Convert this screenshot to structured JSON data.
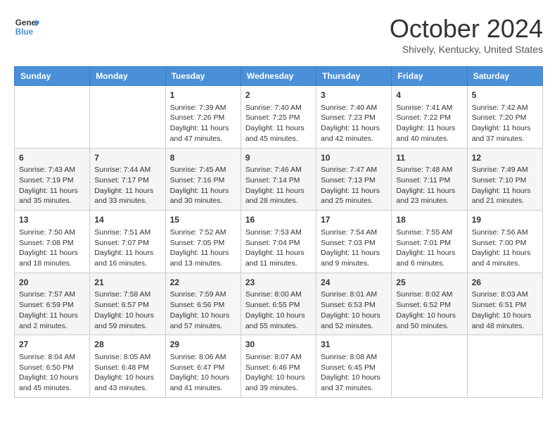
{
  "header": {
    "logo_line1": "General",
    "logo_line2": "Blue",
    "month": "October 2024",
    "location": "Shively, Kentucky, United States"
  },
  "days_of_week": [
    "Sunday",
    "Monday",
    "Tuesday",
    "Wednesday",
    "Thursday",
    "Friday",
    "Saturday"
  ],
  "weeks": [
    [
      {
        "day": "",
        "sunrise": "",
        "sunset": "",
        "daylight": ""
      },
      {
        "day": "",
        "sunrise": "",
        "sunset": "",
        "daylight": ""
      },
      {
        "day": "1",
        "sunrise": "Sunrise: 7:39 AM",
        "sunset": "Sunset: 7:26 PM",
        "daylight": "Daylight: 11 hours and 47 minutes."
      },
      {
        "day": "2",
        "sunrise": "Sunrise: 7:40 AM",
        "sunset": "Sunset: 7:25 PM",
        "daylight": "Daylight: 11 hours and 45 minutes."
      },
      {
        "day": "3",
        "sunrise": "Sunrise: 7:40 AM",
        "sunset": "Sunset: 7:23 PM",
        "daylight": "Daylight: 11 hours and 42 minutes."
      },
      {
        "day": "4",
        "sunrise": "Sunrise: 7:41 AM",
        "sunset": "Sunset: 7:22 PM",
        "daylight": "Daylight: 11 hours and 40 minutes."
      },
      {
        "day": "5",
        "sunrise": "Sunrise: 7:42 AM",
        "sunset": "Sunset: 7:20 PM",
        "daylight": "Daylight: 11 hours and 37 minutes."
      }
    ],
    [
      {
        "day": "6",
        "sunrise": "Sunrise: 7:43 AM",
        "sunset": "Sunset: 7:19 PM",
        "daylight": "Daylight: 11 hours and 35 minutes."
      },
      {
        "day": "7",
        "sunrise": "Sunrise: 7:44 AM",
        "sunset": "Sunset: 7:17 PM",
        "daylight": "Daylight: 11 hours and 33 minutes."
      },
      {
        "day": "8",
        "sunrise": "Sunrise: 7:45 AM",
        "sunset": "Sunset: 7:16 PM",
        "daylight": "Daylight: 11 hours and 30 minutes."
      },
      {
        "day": "9",
        "sunrise": "Sunrise: 7:46 AM",
        "sunset": "Sunset: 7:14 PM",
        "daylight": "Daylight: 11 hours and 28 minutes."
      },
      {
        "day": "10",
        "sunrise": "Sunrise: 7:47 AM",
        "sunset": "Sunset: 7:13 PM",
        "daylight": "Daylight: 11 hours and 25 minutes."
      },
      {
        "day": "11",
        "sunrise": "Sunrise: 7:48 AM",
        "sunset": "Sunset: 7:11 PM",
        "daylight": "Daylight: 11 hours and 23 minutes."
      },
      {
        "day": "12",
        "sunrise": "Sunrise: 7:49 AM",
        "sunset": "Sunset: 7:10 PM",
        "daylight": "Daylight: 11 hours and 21 minutes."
      }
    ],
    [
      {
        "day": "13",
        "sunrise": "Sunrise: 7:50 AM",
        "sunset": "Sunset: 7:08 PM",
        "daylight": "Daylight: 11 hours and 18 minutes."
      },
      {
        "day": "14",
        "sunrise": "Sunrise: 7:51 AM",
        "sunset": "Sunset: 7:07 PM",
        "daylight": "Daylight: 11 hours and 16 minutes."
      },
      {
        "day": "15",
        "sunrise": "Sunrise: 7:52 AM",
        "sunset": "Sunset: 7:05 PM",
        "daylight": "Daylight: 11 hours and 13 minutes."
      },
      {
        "day": "16",
        "sunrise": "Sunrise: 7:53 AM",
        "sunset": "Sunset: 7:04 PM",
        "daylight": "Daylight: 11 hours and 11 minutes."
      },
      {
        "day": "17",
        "sunrise": "Sunrise: 7:54 AM",
        "sunset": "Sunset: 7:03 PM",
        "daylight": "Daylight: 11 hours and 9 minutes."
      },
      {
        "day": "18",
        "sunrise": "Sunrise: 7:55 AM",
        "sunset": "Sunset: 7:01 PM",
        "daylight": "Daylight: 11 hours and 6 minutes."
      },
      {
        "day": "19",
        "sunrise": "Sunrise: 7:56 AM",
        "sunset": "Sunset: 7:00 PM",
        "daylight": "Daylight: 11 hours and 4 minutes."
      }
    ],
    [
      {
        "day": "20",
        "sunrise": "Sunrise: 7:57 AM",
        "sunset": "Sunset: 6:59 PM",
        "daylight": "Daylight: 11 hours and 2 minutes."
      },
      {
        "day": "21",
        "sunrise": "Sunrise: 7:58 AM",
        "sunset": "Sunset: 6:57 PM",
        "daylight": "Daylight: 10 hours and 59 minutes."
      },
      {
        "day": "22",
        "sunrise": "Sunrise: 7:59 AM",
        "sunset": "Sunset: 6:56 PM",
        "daylight": "Daylight: 10 hours and 57 minutes."
      },
      {
        "day": "23",
        "sunrise": "Sunrise: 8:00 AM",
        "sunset": "Sunset: 6:55 PM",
        "daylight": "Daylight: 10 hours and 55 minutes."
      },
      {
        "day": "24",
        "sunrise": "Sunrise: 8:01 AM",
        "sunset": "Sunset: 6:53 PM",
        "daylight": "Daylight: 10 hours and 52 minutes."
      },
      {
        "day": "25",
        "sunrise": "Sunrise: 8:02 AM",
        "sunset": "Sunset: 6:52 PM",
        "daylight": "Daylight: 10 hours and 50 minutes."
      },
      {
        "day": "26",
        "sunrise": "Sunrise: 8:03 AM",
        "sunset": "Sunset: 6:51 PM",
        "daylight": "Daylight: 10 hours and 48 minutes."
      }
    ],
    [
      {
        "day": "27",
        "sunrise": "Sunrise: 8:04 AM",
        "sunset": "Sunset: 6:50 PM",
        "daylight": "Daylight: 10 hours and 45 minutes."
      },
      {
        "day": "28",
        "sunrise": "Sunrise: 8:05 AM",
        "sunset": "Sunset: 6:48 PM",
        "daylight": "Daylight: 10 hours and 43 minutes."
      },
      {
        "day": "29",
        "sunrise": "Sunrise: 8:06 AM",
        "sunset": "Sunset: 6:47 PM",
        "daylight": "Daylight: 10 hours and 41 minutes."
      },
      {
        "day": "30",
        "sunrise": "Sunrise: 8:07 AM",
        "sunset": "Sunset: 6:46 PM",
        "daylight": "Daylight: 10 hours and 39 minutes."
      },
      {
        "day": "31",
        "sunrise": "Sunrise: 8:08 AM",
        "sunset": "Sunset: 6:45 PM",
        "daylight": "Daylight: 10 hours and 37 minutes."
      },
      {
        "day": "",
        "sunrise": "",
        "sunset": "",
        "daylight": ""
      },
      {
        "day": "",
        "sunrise": "",
        "sunset": "",
        "daylight": ""
      }
    ]
  ]
}
